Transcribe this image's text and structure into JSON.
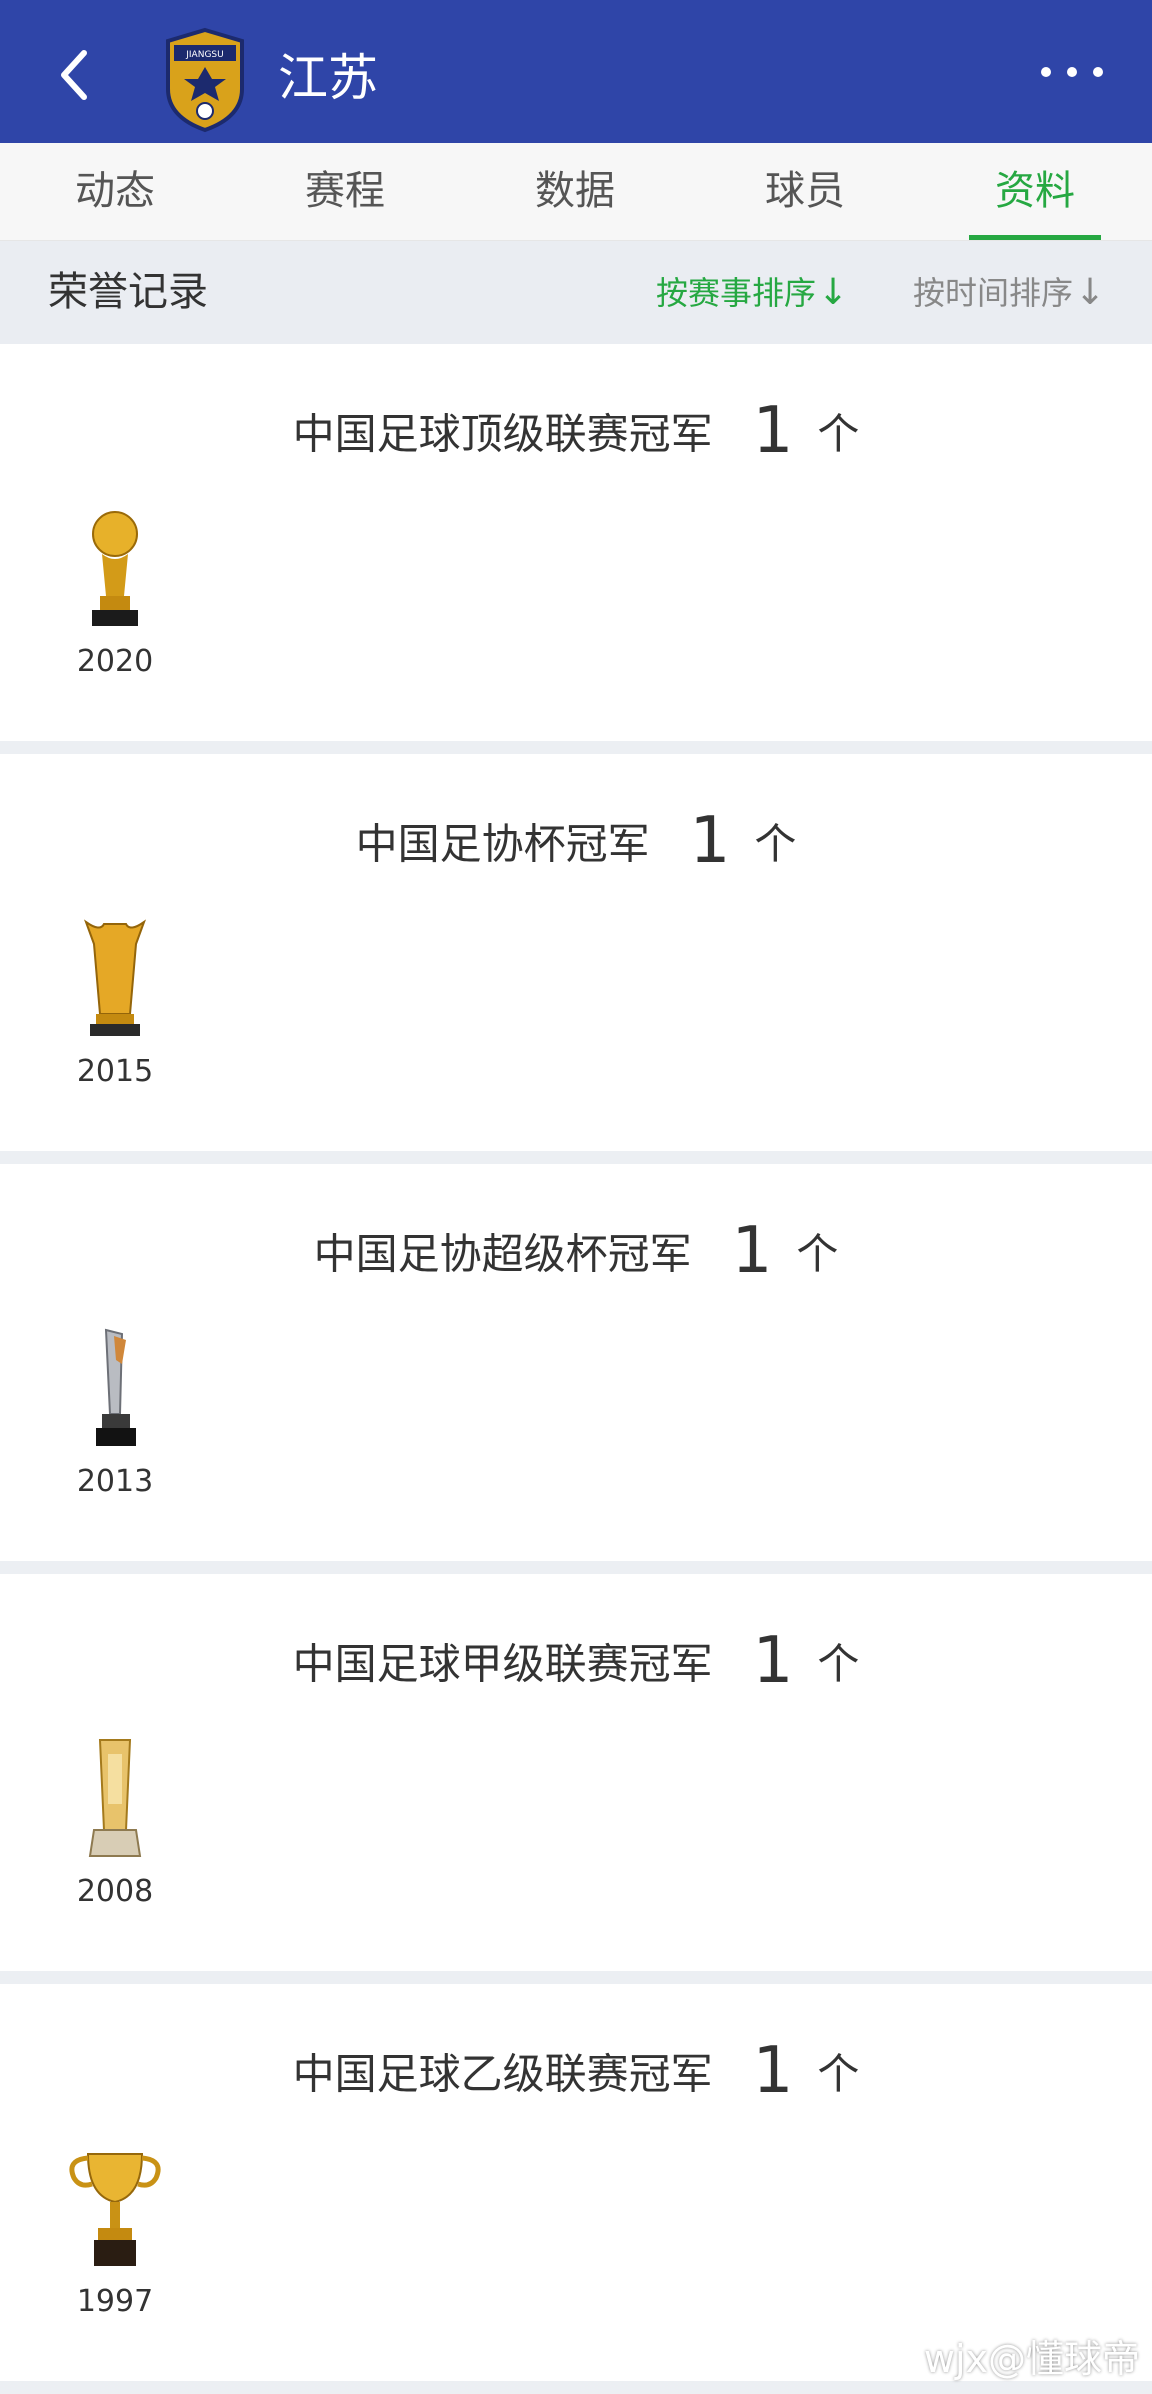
{
  "header": {
    "team_name": "江苏",
    "logo_text": "JIANGSU",
    "brand_color": "#2f45a8"
  },
  "tabs": [
    {
      "label": "动态",
      "active": false
    },
    {
      "label": "赛程",
      "active": false
    },
    {
      "label": "数据",
      "active": false
    },
    {
      "label": "球员",
      "active": false
    },
    {
      "label": "资料",
      "active": true
    }
  ],
  "section": {
    "title": "荣誉记录",
    "sort_by_competition": "按赛事排序",
    "sort_by_time": "按时间排序",
    "active_color": "#26a842"
  },
  "honors": [
    {
      "title": "中国足球顶级联赛冠军",
      "count": "1",
      "unit": "个",
      "year": "2020",
      "trophy_icon": "ball-trophy-icon"
    },
    {
      "title": "中国足协杯冠军",
      "count": "1",
      "unit": "个",
      "year": "2015",
      "trophy_icon": "column-trophy-icon"
    },
    {
      "title": "中国足协超级杯冠军",
      "count": "1",
      "unit": "个",
      "year": "2013",
      "trophy_icon": "silver-spire-trophy-icon"
    },
    {
      "title": "中国足球甲级联赛冠军",
      "count": "1",
      "unit": "个",
      "year": "2008",
      "trophy_icon": "crystal-trophy-icon"
    },
    {
      "title": "中国足球乙级联赛冠军",
      "count": "1",
      "unit": "个",
      "year": "1997",
      "trophy_icon": "cup-trophy-icon"
    }
  ],
  "watermark": "wjx@懂球帝"
}
